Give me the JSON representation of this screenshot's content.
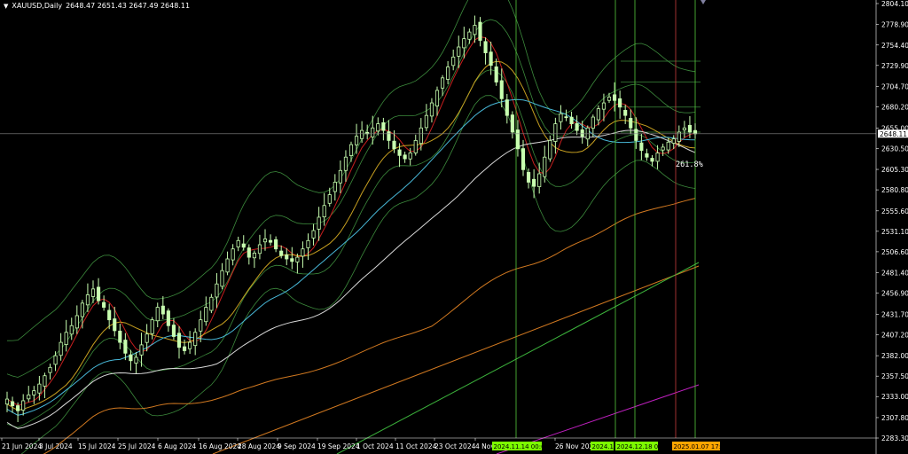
{
  "header": {
    "symbol": "XAUUSD,Daily",
    "ohlc": "2648.47 2651.43 2647.49 2648.11"
  },
  "current_price": "2648.11",
  "fib_label": "261.8%",
  "price_axis": [
    "2804.10",
    "2778.90",
    "2754.40",
    "2729.90",
    "2704.70",
    "2680.20",
    "2655.00",
    "2630.50",
    "2605.30",
    "2580.80",
    "2555.60",
    "2531.10",
    "2506.60",
    "2481.40",
    "2456.90",
    "2431.70",
    "2407.20",
    "2382.00",
    "2357.50",
    "2333.00",
    "2307.80",
    "2283.30"
  ],
  "time_axis": [
    "21 Jun 2024",
    "3 Jul 2024",
    "15 Jul 2024",
    "25 Jul 2024",
    "6 Aug 2024",
    "16 Aug 2024",
    "28 Aug 2024",
    "9 Sep 2024",
    "19 Sep 2024",
    "1 Oct 2024",
    "11 Oct 2024",
    "23 Oct 2024",
    "4 Nov",
    "26 Nov 2024"
  ],
  "vertical_tags": [
    {
      "text": "2024.11.14 00:00",
      "color": "#7CFC00"
    },
    {
      "text": "2024.1",
      "color": "#7CFC00"
    },
    {
      "text": "2024.12.18 00",
      "color": "#7CFC00"
    },
    {
      "text": "2024.1",
      "color": "#ff2020"
    },
    {
      "text": "2025.01.07 17:00",
      "color": "#FFA500"
    }
  ],
  "colors": {
    "background": "#000000",
    "candle": "#C8FFB0",
    "band": "#3C8A3C",
    "ma_red": "#C81E1E",
    "ma_yellow": "#C8A020",
    "ma_cyan": "#48B8D8",
    "ma_white": "#D8D8D8",
    "ma_orange": "#D07820",
    "ma_green": "#3CB43C",
    "ma_magenta": "#C020C0",
    "vline_green": "#56C83C",
    "vline_red": "#C83C3C"
  },
  "chart_data": {
    "type": "candlestick",
    "symbol": "XAUUSD",
    "timeframe": "Daily",
    "ylim": [
      2283.3,
      2804.1
    ],
    "closes": [
      2330,
      2322,
      2316,
      2328,
      2335,
      2340,
      2348,
      2358,
      2368,
      2382,
      2398,
      2410,
      2418,
      2430,
      2445,
      2455,
      2462,
      2448,
      2440,
      2425,
      2412,
      2398,
      2385,
      2376,
      2380,
      2395,
      2408,
      2425,
      2440,
      2432,
      2418,
      2405,
      2392,
      2388,
      2398,
      2410,
      2425,
      2440,
      2452,
      2468,
      2484,
      2498,
      2510,
      2520,
      2512,
      2500,
      2505,
      2515,
      2522,
      2518,
      2510,
      2502,
      2498,
      2495,
      2500,
      2510,
      2520,
      2532,
      2548,
      2562,
      2575,
      2590,
      2604,
      2620,
      2635,
      2645,
      2652,
      2648,
      2655,
      2660,
      2652,
      2640,
      2630,
      2622,
      2618,
      2625,
      2640,
      2655,
      2670,
      2685,
      2700,
      2715,
      2728,
      2740,
      2752,
      2762,
      2770,
      2778,
      2760,
      2745,
      2730,
      2710,
      2690,
      2670,
      2650,
      2630,
      2605,
      2590,
      2585,
      2600,
      2620,
      2640,
      2660,
      2672,
      2668,
      2660,
      2652,
      2645,
      2655,
      2668,
      2678,
      2685,
      2692,
      2688,
      2680,
      2670,
      2655,
      2640,
      2628,
      2620,
      2615,
      2625,
      2632,
      2638,
      2642,
      2650,
      2655,
      2650,
      2648
    ]
  }
}
